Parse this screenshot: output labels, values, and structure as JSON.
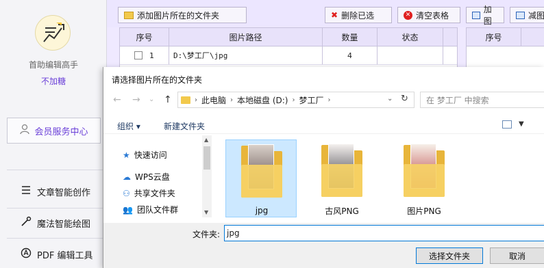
{
  "sidebar": {
    "app_name": "首助编辑高手",
    "slogan": "不加糖",
    "member_center": "会员服务中心",
    "nav": [
      {
        "label": "文章智能创作",
        "icon": "menu-lines-icon"
      },
      {
        "label": "魔法智能绘图",
        "icon": "magic-wand-icon"
      },
      {
        "label": "PDF 编辑工具",
        "icon": "pdf-icon"
      }
    ]
  },
  "toolbar": {
    "add_folder": "添加图片所在的文件夹",
    "delete_selected": "删除已选",
    "clear_table": "清空表格",
    "add_image": "加图",
    "remove_image": "减图"
  },
  "left_table": {
    "headers": [
      "序号",
      "图片路径",
      "数量",
      "状态"
    ],
    "rows": [
      {
        "index": "1",
        "path": "D:\\梦工厂\\jpg",
        "count": "4",
        "status": ""
      }
    ]
  },
  "right_table": {
    "headers": [
      "序号"
    ]
  },
  "dialog": {
    "title": "请选择图片所在的文件夹",
    "breadcrumbs": [
      "此电脑",
      "本地磁盘 (D:)",
      "梦工厂"
    ],
    "search_placeholder": "在 梦工厂 中搜索",
    "organize": "组织 ▾",
    "new_folder": "新建文件夹",
    "nav_items": [
      "快速访问",
      "WPS云盘",
      "共享文件夹",
      "团队文件群"
    ],
    "folders": [
      {
        "name": "jpg",
        "selected": true
      },
      {
        "name": "古风PNG",
        "selected": false
      },
      {
        "name": "图片PNG",
        "selected": false
      }
    ],
    "folder_label": "文件夹:",
    "folder_value": "jpg",
    "select_button": "选择文件夹",
    "cancel_button": "取消"
  }
}
